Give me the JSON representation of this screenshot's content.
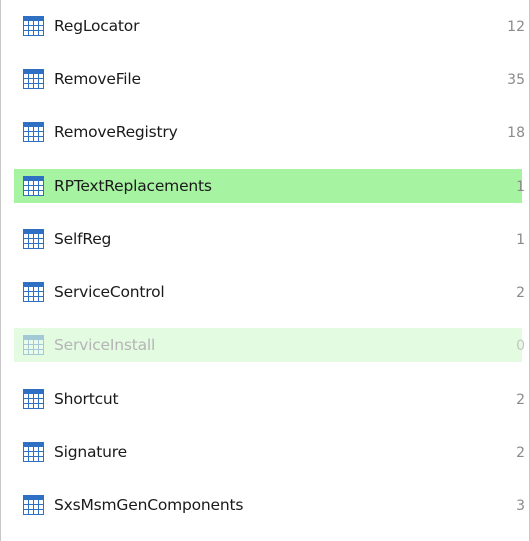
{
  "tables": [
    {
      "name": "RegLocator",
      "count": "12",
      "state": "normal",
      "icon": "table-icon"
    },
    {
      "name": "RemoveFile",
      "count": "35",
      "state": "normal",
      "icon": "table-icon"
    },
    {
      "name": "RemoveRegistry",
      "count": "18",
      "state": "normal",
      "icon": "table-icon"
    },
    {
      "name": "RPTextReplacements",
      "count": "1",
      "state": "selected",
      "icon": "table-icon"
    },
    {
      "name": "SelfReg",
      "count": "1",
      "state": "normal",
      "icon": "table-icon"
    },
    {
      "name": "ServiceControl",
      "count": "2",
      "state": "normal",
      "icon": "table-icon"
    },
    {
      "name": "ServiceInstall",
      "count": "0",
      "state": "disabled",
      "icon": "table-icon"
    },
    {
      "name": "Shortcut",
      "count": "2",
      "state": "normal",
      "icon": "table-icon"
    },
    {
      "name": "Signature",
      "count": "2",
      "state": "normal",
      "icon": "table-icon"
    },
    {
      "name": "SxsMsmGenComponents",
      "count": "3",
      "state": "normal",
      "icon": "table-icon"
    }
  ],
  "colors": {
    "selected_bg": "#a6f4a2",
    "disabled_bg": "#e3fbe1",
    "icon_blue": "#2f6fc4"
  }
}
